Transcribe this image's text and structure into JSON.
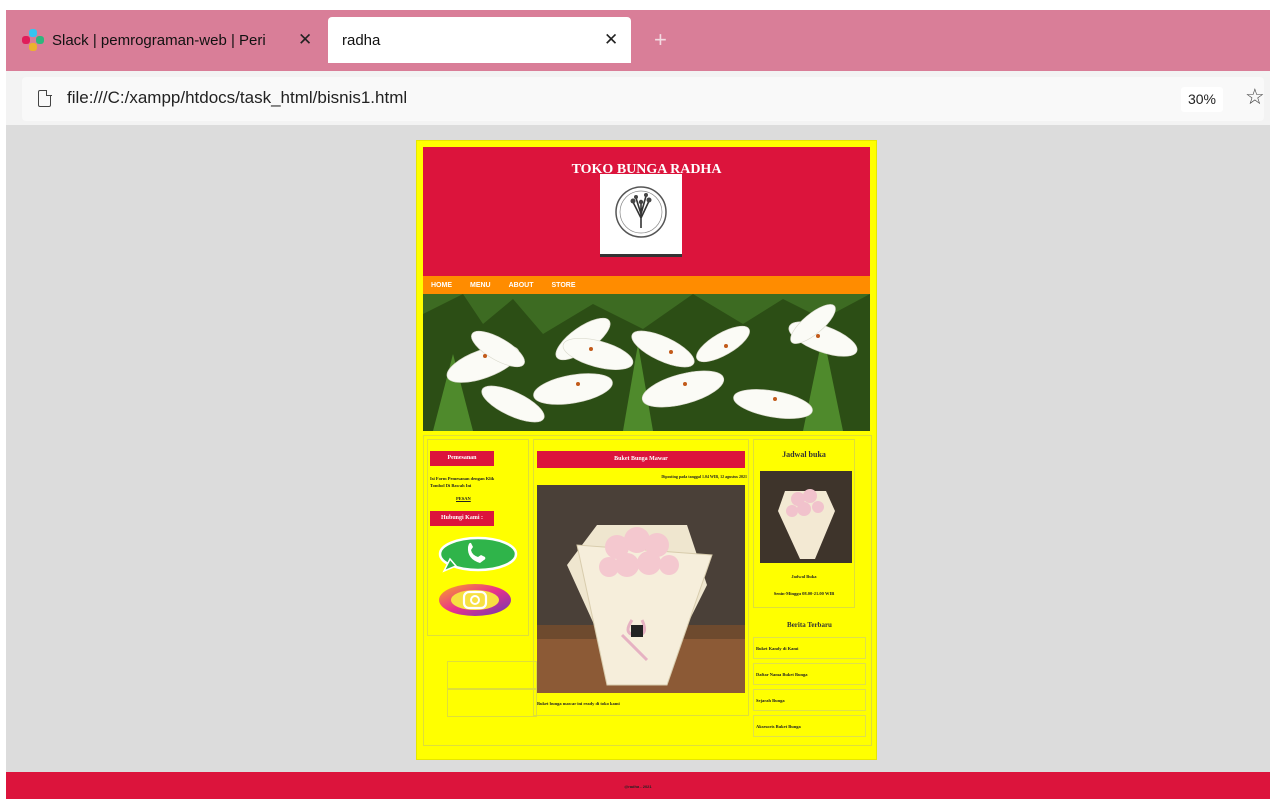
{
  "browser": {
    "tabs": [
      {
        "title": "Slack | pemrograman-web | Peri",
        "active": false
      },
      {
        "title": "radha",
        "active": true
      }
    ],
    "close_glyph": "✕",
    "new_tab_glyph": "+",
    "url": "file:///C:/xampp/htdocs/task_html/bisnis1.html",
    "zoom": "30%",
    "icons": {
      "page": "page-icon",
      "bookmark": "star-icon",
      "slack": "slack-icon"
    }
  },
  "site": {
    "title": "TOKO BUNGA RADHA",
    "nav": [
      "HOME",
      "MENU",
      "ABOUT",
      "STORE"
    ],
    "left": {
      "order_heading": "Pemesanan",
      "order_text": "Isi Form Pemesanan dengan Klik Tombol Di Bawah Ini",
      "order_link": "PESAN",
      "contact_heading": "Hubungi Kami :"
    },
    "main": {
      "heading": "Buket Bunga Mawar",
      "date": "Diposting pada tanggal 1.04 WIB, 12 agustus 2021",
      "caption": "Buket bunga mawar ini ready di toko kami"
    },
    "right": {
      "schedule_title": "Jadwal buka",
      "schedule_label": "Jadwal Buka",
      "schedule_hours": "Senin-Minggu 08.00-21.00 WIB",
      "news_title": "Berita Terbaru",
      "news": [
        "Buket Kandy di Kami",
        "Daftar Nama Buket Bunga",
        "Sejarah Bunga",
        "Aksesoris Buket Bunga"
      ]
    },
    "footer": "@radha - 2021"
  },
  "colors": {
    "tabbar": "#d97e98",
    "header": "#dc143c",
    "nav": "#ff8c00",
    "page": "#ffff00",
    "footer": "#dc143c"
  }
}
